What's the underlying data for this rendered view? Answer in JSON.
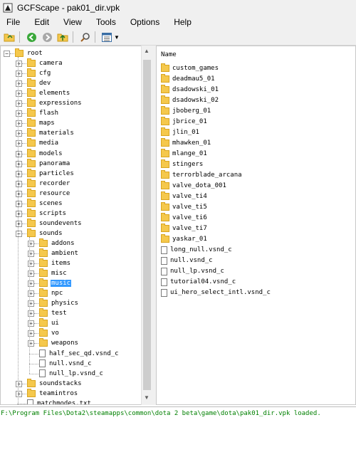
{
  "window": {
    "title": "GCFScape - pak01_dir.vpk"
  },
  "menu": [
    "File",
    "Edit",
    "View",
    "Tools",
    "Options",
    "Help"
  ],
  "tree": {
    "root": "root",
    "top_items": [
      "camera",
      "cfg",
      "dev",
      "elements",
      "expressions",
      "flash",
      "maps",
      "materials",
      "media",
      "models",
      "panorama",
      "particles",
      "recorder",
      "resource",
      "scenes",
      "scripts",
      "soundevents",
      "sounds"
    ],
    "sounds_children": [
      "addons",
      "ambient",
      "items",
      "misc",
      "music",
      "npc",
      "physics",
      "test",
      "ui",
      "vo",
      "weapons"
    ],
    "sounds_files": [
      "half_sec_qd.vsnd_c",
      "null.vsnd_c",
      "null_lp.vsnd_c"
    ],
    "after_items": [
      "soundstacks",
      "teamintros"
    ],
    "partial_item": "matchmodes.txt",
    "selected": "music"
  },
  "list": {
    "header": "Name",
    "folders": [
      "custom_games",
      "deadmau5_01",
      "dsadowski_01",
      "dsadowski_02",
      "jboberg_01",
      "jbrice_01",
      "jlin_01",
      "mhawken_01",
      "mlange_01",
      "stingers",
      "terrorblade_arcana",
      "valve_dota_001",
      "valve_ti4",
      "valve_ti5",
      "valve_ti6",
      "valve_ti7",
      "yaskar_01"
    ],
    "files": [
      "long_null.vsnd_c",
      "null.vsnd_c",
      "null_lp.vsnd_c",
      "tutorial04.vsnd_c",
      "ui_hero_select_intl.vsnd_c"
    ]
  },
  "status": "F:\\Program Files\\Dota2\\steamapps\\common\\dota 2 beta\\game\\dota\\pak01_dir.vpk loaded.",
  "colors": {
    "status_text": "#008000",
    "selection": "#3399ff",
    "folder": "#f5c84c"
  }
}
